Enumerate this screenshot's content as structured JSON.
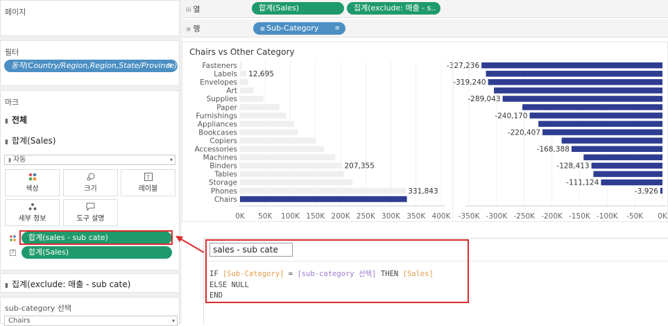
{
  "left": {
    "pages_header": "페이지",
    "filters_header": "필터",
    "filter_pill": "동작(Country/Region,Region,State/Province)",
    "marks_header": "마크",
    "marks_all": "전체",
    "marks_sales": "합계(Sales)",
    "mark_type": "자동",
    "buttons": [
      "색상",
      "크기",
      "레이블",
      "세부 정보",
      "도구 설명"
    ],
    "pill_sales_subcate": "합계(sales - sub cate)",
    "pill_sales": "합계(Sales)",
    "marks_exclude": "집계(exclude: 매출 - sub cate)",
    "param_header": "sub-category 선택",
    "param_value": "Chairs"
  },
  "shelves": {
    "columns_label": "열",
    "columns_pills": [
      "합계(Sales)",
      "집계(exclude: 매출 - s.."
    ],
    "rows_label": "행",
    "rows_pill": "Sub-Category"
  },
  "chart_data": {
    "type": "bar",
    "title": "Chairs vs Other Category",
    "categories": [
      "Fasteners",
      "Labels",
      "Envelopes",
      "Art",
      "Supplies",
      "Paper",
      "Furnishings",
      "Appliances",
      "Bookcases",
      "Copiers",
      "Accessories",
      "Machines",
      "Binders",
      "Tables",
      "Storage",
      "Phones",
      "Chairs"
    ],
    "series": [
      {
        "values": [
          3024,
          12695,
          16476,
          27119,
          46674,
          78479,
          91705,
          107532,
          114880,
          149528,
          167380,
          189239,
          203413,
          206966,
          223844,
          330007,
          331843
        ]
      },
      {
        "values": [
          -327236,
          -319240,
          -315367,
          -304724,
          -289043,
          -253364,
          -240170,
          -224311,
          -216963,
          -182315,
          -164463,
          -142604,
          -128413,
          -124877,
          -111124,
          -3926,
          0
        ]
      }
    ],
    "data_labels_left": {
      "Labels": "12,695",
      "Binders": "207,355",
      "Phones": "331,843"
    },
    "data_labels_right": {
      "Fasteners": "-327,236",
      "Envelopes": "-319,240",
      "Supplies": "-289,043",
      "Furnishings": "-240,170",
      "Bookcases": "-220,407",
      "Accessories": "-168,388",
      "Binders": "-128,413",
      "Storage": "-111,124",
      "Phones": "-3,926"
    },
    "xlim_left": [
      0,
      400000
    ],
    "xlim_right": [
      -350000,
      0
    ],
    "ticks_left": [
      "0K",
      "50K",
      "100K",
      "150K",
      "200K",
      "250K",
      "300K",
      "350K",
      "400K"
    ],
    "ticks_right": [
      "-350K",
      "-300K",
      "-250K",
      "-200K",
      "-150K",
      "-100K",
      "-50K",
      "0K"
    ],
    "colors": {
      "highlight": "#2e3d91",
      "other": "#efefef",
      "right": "#2e3d91"
    }
  },
  "calc": {
    "name": "sales - sub cate",
    "line1_if": "IF ",
    "line1_field": "[Sub-Category]",
    "line1_eq": " = ",
    "line1_param": "[sub-category 선택]",
    "line1_then": " THEN ",
    "line1_sales": "[Sales]",
    "line2": "ELSE NULL",
    "line3": "END"
  }
}
